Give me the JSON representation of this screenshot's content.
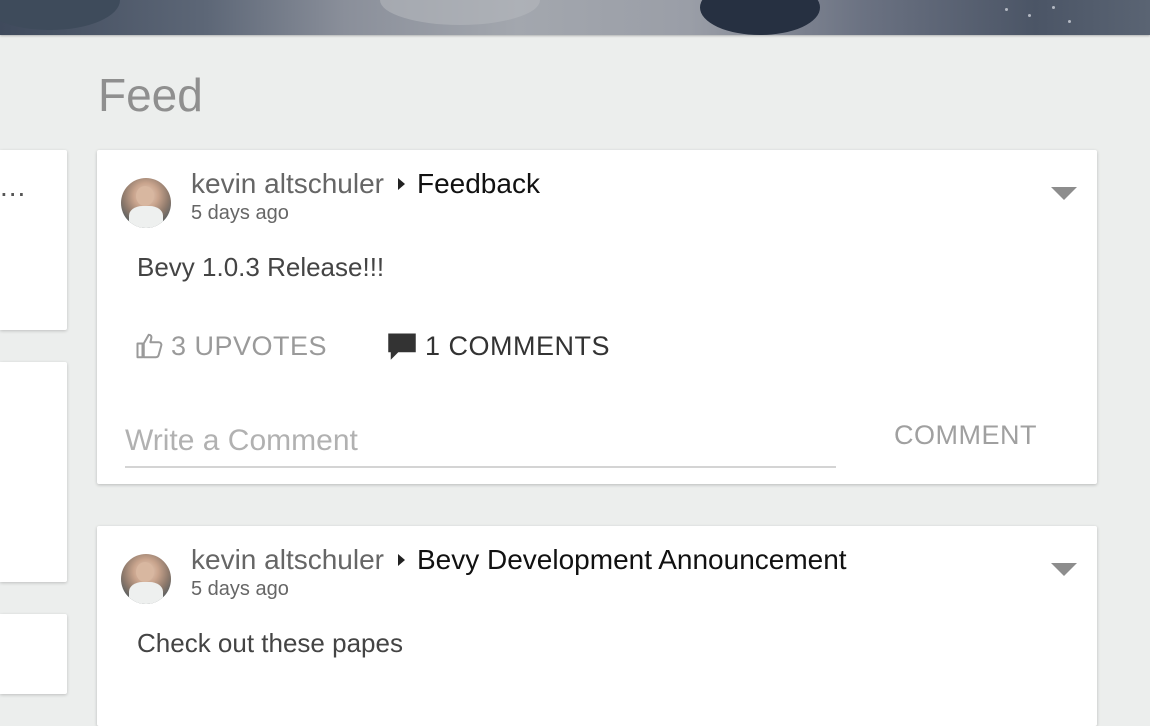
{
  "page": {
    "feed_title": "Feed"
  },
  "side_cards": [
    {
      "preview_text": "..."
    }
  ],
  "posts": [
    {
      "author": "kevin altschuler",
      "board": "Feedback",
      "timestamp": "5 days ago",
      "body": "Bevy 1.0.3 Release!!!",
      "upvotes_label": "3 UPVOTES",
      "comments_label": "1 COMMENTS",
      "comment_placeholder": "Write a Comment",
      "comment_button": "COMMENT"
    },
    {
      "author": "kevin altschuler",
      "board": "Bevy Development Announcement",
      "timestamp": "5 days ago",
      "body": "Check out these papes"
    }
  ],
  "icons": {
    "thumbs_up": "thumbs-up-icon",
    "comment": "comment-icon",
    "caret": "caret-right-icon",
    "menu": "chevron-down-icon"
  },
  "colors": {
    "background": "#eceeed",
    "card": "#ffffff",
    "muted_text": "#9a9a9a",
    "title_text": "#8f8f8f"
  }
}
